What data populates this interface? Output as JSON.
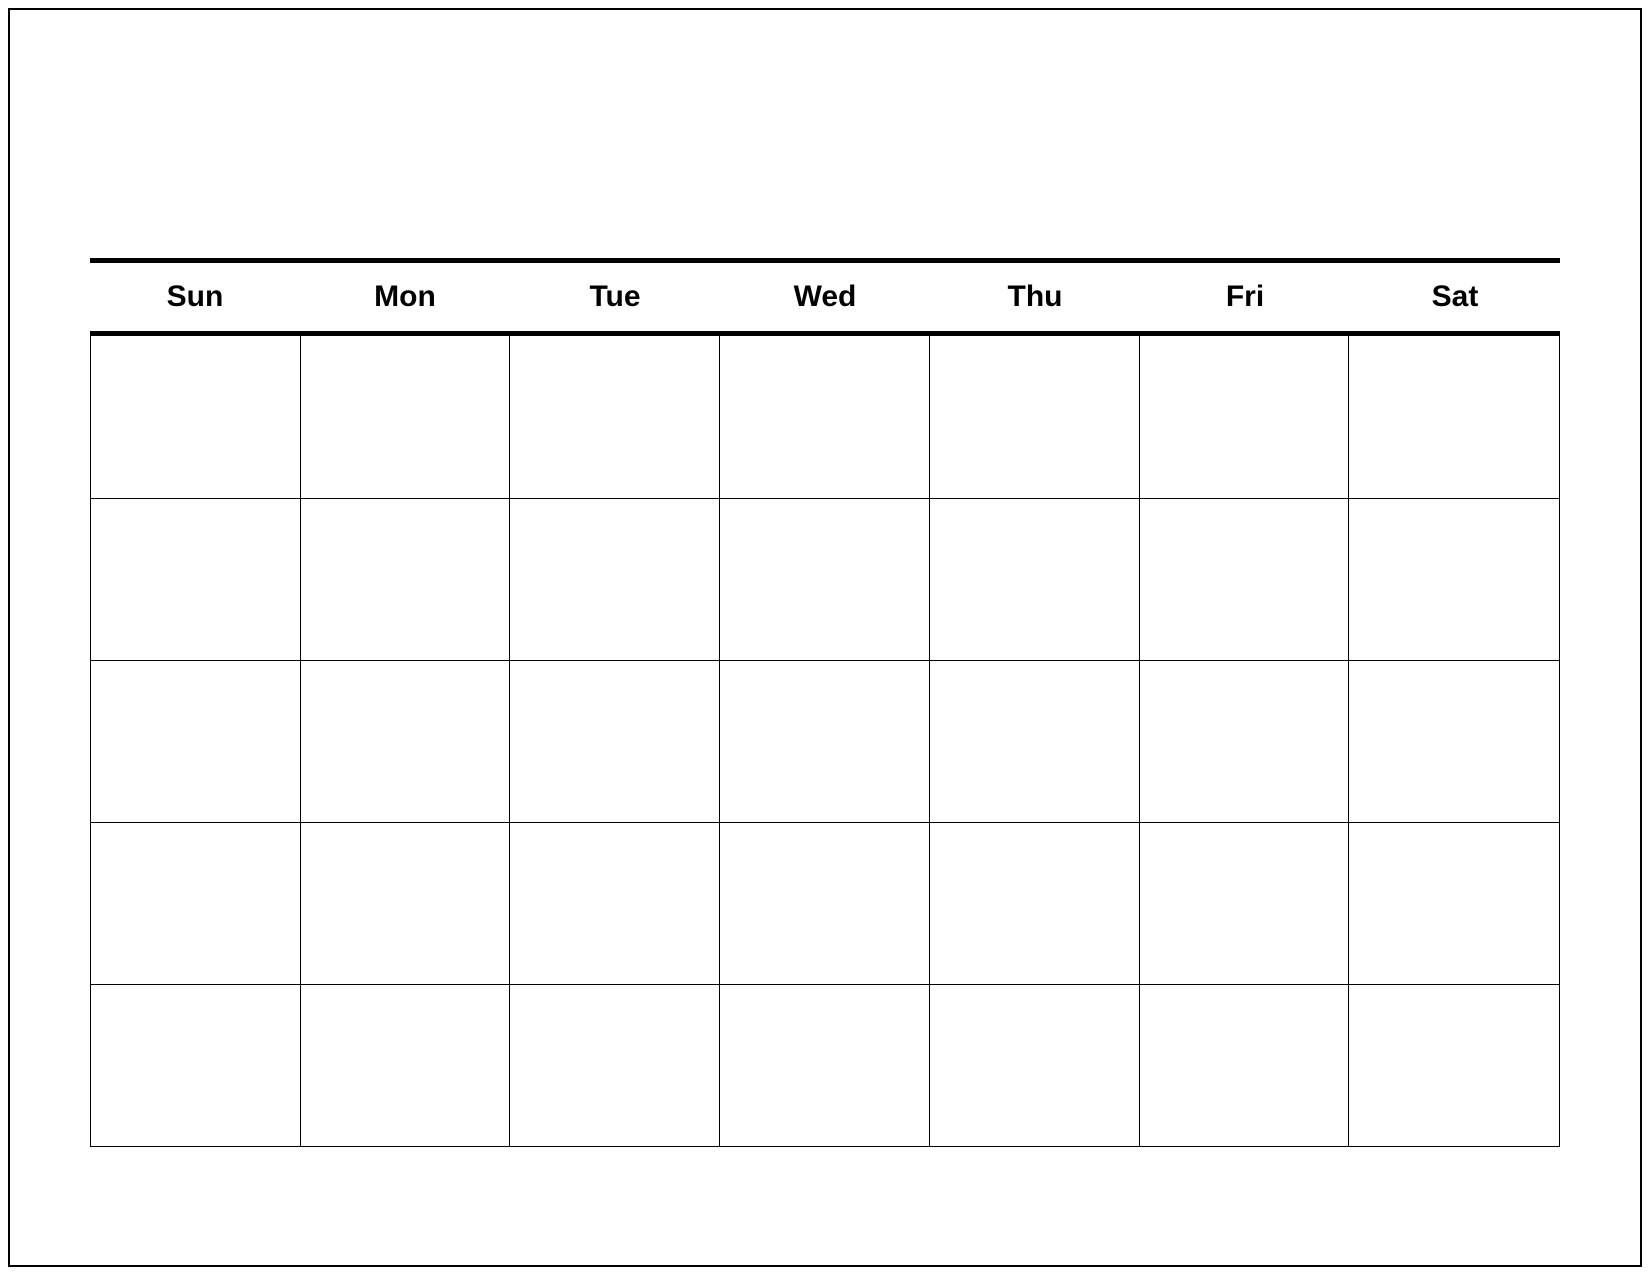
{
  "calendar": {
    "days": [
      "Sun",
      "Mon",
      "Tue",
      "Wed",
      "Thu",
      "Fri",
      "Sat"
    ],
    "weeks": 5
  }
}
